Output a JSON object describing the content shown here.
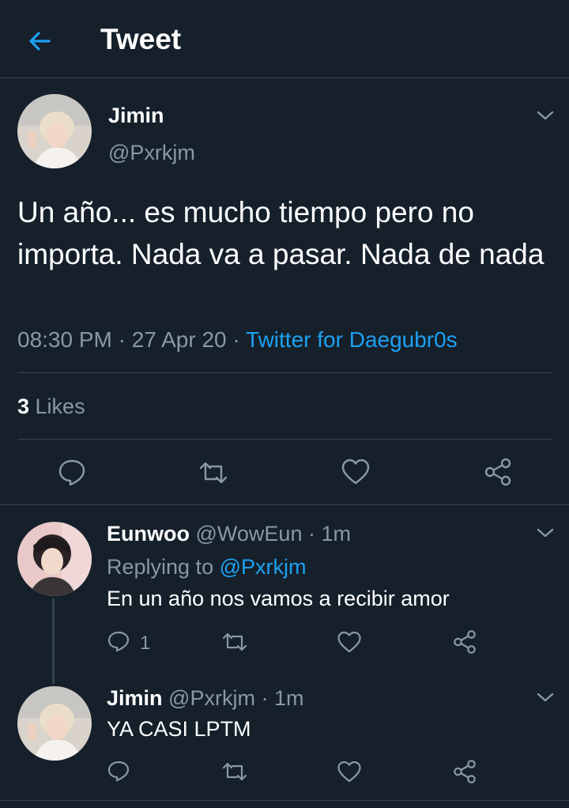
{
  "header": {
    "title": "Tweet",
    "back_icon": "back-arrow-icon",
    "accent": "#1da1f2"
  },
  "main_tweet": {
    "name": "Jimin",
    "handle": "@Pxrkjm",
    "text": "Un año... es mucho tiempo pero no importa. Nada va a pasar. Nada de nada",
    "time": "08:30 PM",
    "sep1": " · ",
    "date": "27 Apr 20",
    "sep2": " · ",
    "source": "Twitter for Daegubr0s",
    "likes_count": "3",
    "likes_label": " Likes"
  },
  "replies": [
    {
      "name": "Eunwoo",
      "handle": "@WowEun",
      "sep": " · ",
      "time": "1m",
      "replying_label": "Replying to ",
      "replying_handle": "@Pxrkjm",
      "text": "En un año nos vamos a recibir amor",
      "reply_count": "1"
    },
    {
      "name": "Jimin",
      "handle": "@Pxrkjm",
      "sep": " · ",
      "time": "1m",
      "text": "YA CASI LPTM"
    }
  ],
  "colors": {
    "background": "#15202b",
    "muted": "#8899a6",
    "divider": "#38444d",
    "accent": "#1da1f2"
  }
}
